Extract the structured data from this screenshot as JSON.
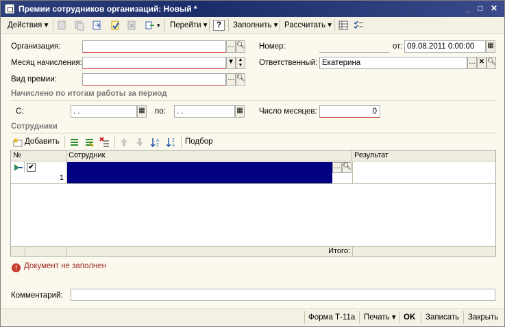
{
  "window": {
    "title": "Премии сотрудников организаций: Новый *"
  },
  "toolbar": {
    "actions": "Действия",
    "goto": "Перейти",
    "help": "?",
    "fill": "Заполнить",
    "calculate": "Рассчитать"
  },
  "form": {
    "organization_label": "Организация:",
    "organization_value": "",
    "accrual_month_label": "Месяц начисления:",
    "accrual_month_value": "",
    "bonus_type_label": "Вид премии:",
    "bonus_type_value": "",
    "number_label": "Номер:",
    "number_value": "",
    "from_label": "от:",
    "date_value": "09.08.2011  0:00:00",
    "responsible_label": "Ответственный:",
    "responsible_value": "Екатерина",
    "period_section": "Начислено по итогам работы за период",
    "from_period_label": "С:",
    "from_period_value": " .  .",
    "to_period_label": "по:",
    "to_period_value": " .  .",
    "months_label": "Число месяцев:",
    "months_value": "0",
    "employees_section": "Сотрудники",
    "comment_label": "Комментарий:",
    "comment_value": ""
  },
  "grid_toolbar": {
    "add": "Добавить",
    "pick": "Подбор"
  },
  "grid": {
    "columns": [
      "№",
      "Сотрудник",
      "Результат"
    ],
    "rows": [
      {
        "number": "1",
        "employee": "",
        "result": ""
      }
    ],
    "total_label": "Итого:"
  },
  "warning": "Документ не заполнен",
  "bottombar": {
    "form_t11a": "Форма Т-11а",
    "print": "Печать",
    "ok": "OK",
    "save": "Записать",
    "close": "Закрыть"
  },
  "colors": {
    "selection": "#000080",
    "warning": "#a0261c"
  }
}
